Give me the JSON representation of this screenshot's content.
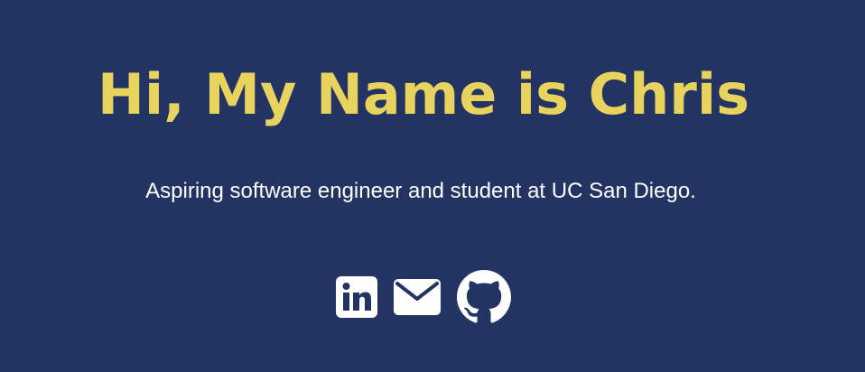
{
  "hero": {
    "title": "Hi, My Name is Chris",
    "subtitle": "Aspiring software engineer and student at UC San Diego."
  },
  "social": [
    {
      "icon": "linkedin-icon"
    },
    {
      "icon": "mail-icon"
    },
    {
      "icon": "github-icon"
    }
  ],
  "colors": {
    "background": "#233462",
    "title": "#E8D35E",
    "text": "#FFFFFF"
  }
}
